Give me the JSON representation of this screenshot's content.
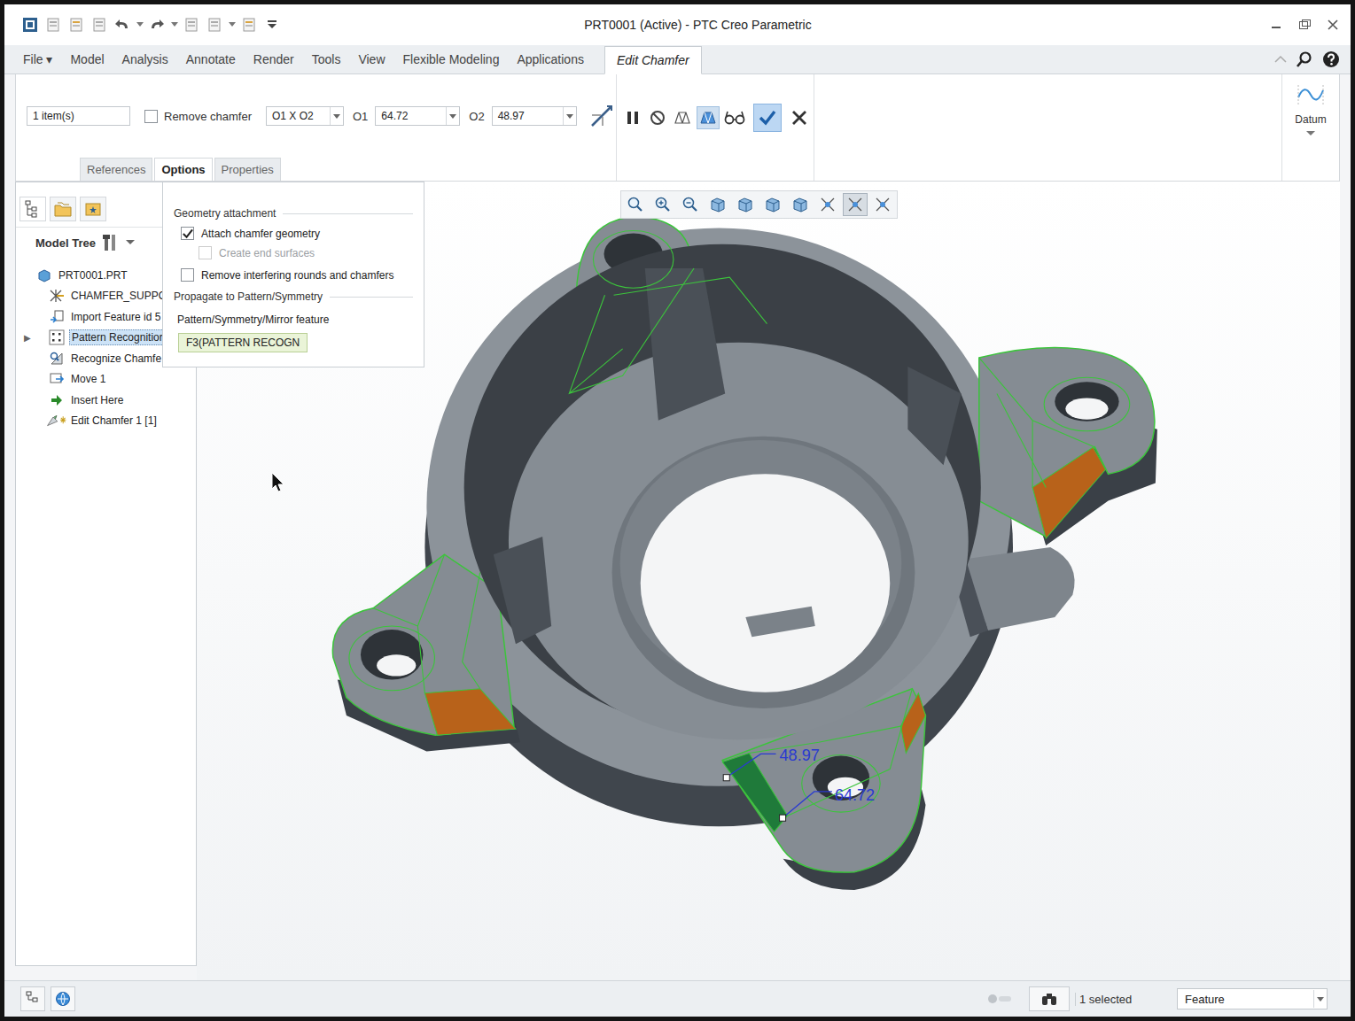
{
  "window": {
    "title": "PRT0001 (Active) - PTC Creo Parametric"
  },
  "menu_tabs": [
    {
      "label": "File ▾",
      "selected": false
    },
    {
      "label": "Model",
      "selected": false
    },
    {
      "label": "Analysis",
      "selected": false
    },
    {
      "label": "Annotate",
      "selected": false
    },
    {
      "label": "Render",
      "selected": false
    },
    {
      "label": "Tools",
      "selected": false
    },
    {
      "label": "View",
      "selected": false
    },
    {
      "label": "Flexible Modeling",
      "selected": false
    },
    {
      "label": "Applications",
      "selected": false
    },
    {
      "label": "Edit Chamfer",
      "selected": true
    }
  ],
  "dashboard": {
    "items_field": "1 item(s)",
    "remove_chamfer": {
      "label": "Remove chamfer",
      "checked": false
    },
    "scheme": "O1 X O2",
    "d1": {
      "label": "O1",
      "value": "64.72"
    },
    "d2": {
      "label": "O2",
      "value": "48.97"
    }
  },
  "sub_tabs": [
    {
      "label": "References",
      "selected": false
    },
    {
      "label": "Options",
      "selected": true
    },
    {
      "label": "Properties",
      "selected": false
    }
  ],
  "datum": {
    "label": "Datum"
  },
  "options_panel": {
    "section1": "Geometry attachment",
    "checkboxes": [
      {
        "label": "Attach chamfer geometry",
        "checked": true,
        "disabled": false,
        "indent": false
      },
      {
        "label": "Create end surfaces",
        "checked": false,
        "disabled": true,
        "indent": true
      },
      {
        "label": "Remove interfering rounds and chamfers",
        "checked": false,
        "disabled": false,
        "indent": false
      }
    ],
    "section2": "Propagate to Pattern/Symmetry",
    "field_label": "Pattern/Symmetry/Mirror feature",
    "field_value": "F3(PATTERN RECOGN"
  },
  "model_tree": {
    "title": "Model Tree",
    "expander": "▶",
    "items": [
      {
        "label": "PRT0001.PRT",
        "kind": "part",
        "has_children": false,
        "selected": false
      },
      {
        "label": "CHAMFER_SUPPOI",
        "kind": "csys",
        "has_children": false,
        "selected": false
      },
      {
        "label": "Import Feature id 5",
        "kind": "import",
        "has_children": false,
        "selected": false
      },
      {
        "label": "Pattern Recognitior",
        "kind": "pattern",
        "has_children": true,
        "selected": true
      },
      {
        "label": "Recognize Chamfe",
        "kind": "recognize",
        "has_children": false,
        "selected": false
      },
      {
        "label": "Move 1",
        "kind": "move",
        "has_children": false,
        "selected": false
      },
      {
        "label": "Insert Here",
        "kind": "insert",
        "has_children": false,
        "selected": false
      },
      {
        "label": "Edit Chamfer 1 [1]",
        "kind": "chamfer",
        "has_children": false,
        "selected": false
      }
    ]
  },
  "viewport": {
    "dimensions": [
      {
        "value": "48.97"
      },
      {
        "value": "64.72"
      }
    ]
  },
  "status_bar": {
    "selection": "1 selected",
    "filter": "Feature"
  }
}
